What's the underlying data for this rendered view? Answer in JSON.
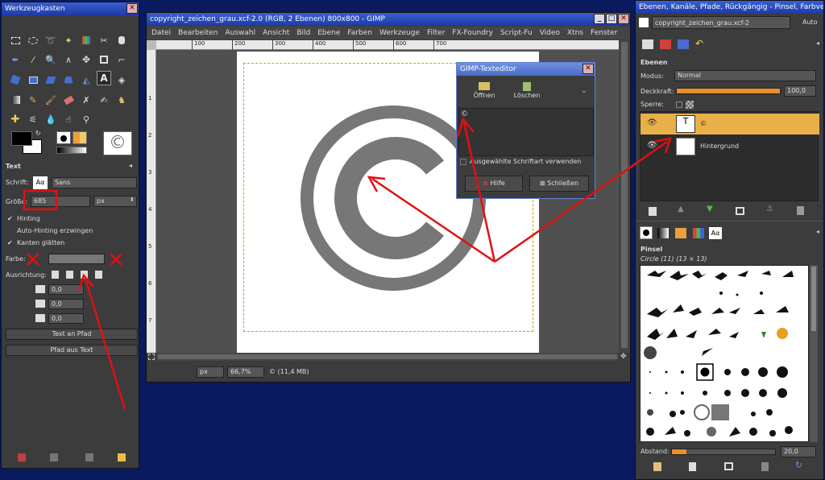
{
  "toolbox": {
    "title": "Werkzeugkasten",
    "text_options": {
      "heading": "Text",
      "font_label": "Schrift:",
      "font_value": "Sans",
      "size_label": "Größe:",
      "size_value": "685",
      "size_unit": "px",
      "hinting": "Hinting",
      "auto_hinting": "Auto-Hinting erzwingen",
      "antialias": "Kanten glätten",
      "color_label": "Farbe:",
      "justify_label": "Ausrichtung:",
      "indent_value": "0,0",
      "line_spacing_value": "0,0",
      "letter_spacing_value": "0,0",
      "text_along_path": "Text an Pfad",
      "path_from_text": "Pfad aus Text"
    },
    "font_icon": "Aα"
  },
  "image_window": {
    "title": "copyright_zeichen_grau.xcf-2.0 (RGB, 2 Ebenen) 800x800 - GIMP",
    "menu": [
      "Datei",
      "Bearbeiten",
      "Auswahl",
      "Ansicht",
      "Bild",
      "Ebene",
      "Farben",
      "Werkzeuge",
      "Filter",
      "FX-Foundry",
      "Script-Fu",
      "Video",
      "Xtns",
      "Fenster"
    ],
    "ruler_ticks": [
      "100",
      "200",
      "300",
      "400",
      "500",
      "600",
      "700"
    ],
    "vruler_ticks": [
      "1",
      "2",
      "3",
      "4",
      "5",
      "6",
      "7"
    ],
    "unit": "px",
    "zoom": "66,7%",
    "status": "© (11,4 MB)",
    "copyright_glyph": "©"
  },
  "text_editor": {
    "title": "GIMP-Texteditor",
    "open_label": "Öffnen",
    "clear_label": "Löschen",
    "text": "©",
    "use_font_label": "Ausgewählte Schriftart verwenden",
    "help_label": "Hilfe",
    "close_label": "Schließen"
  },
  "right_dock": {
    "title": "Ebenen, Kanäle, Pfade, Rückgängig - Pinsel, Farbverlä...",
    "image_select": "copyright_zeichen_grau.xcf-2",
    "auto_label": "Auto",
    "layers_heading": "Ebenen",
    "mode_label": "Modus:",
    "mode_value": "Normal",
    "opacity_label": "Deckkraft:",
    "opacity_value": "100,0",
    "opacity_fraction": 1.0,
    "lock_label": "Sperre:",
    "layers": [
      {
        "name": "©",
        "selected": true
      },
      {
        "name": "Hintergrund",
        "selected": false
      }
    ],
    "brushes_heading": "Pinsel",
    "brush_name": "Circle (11) (13 × 13)",
    "spacing_label": "Abstand:",
    "spacing_value": "20,0",
    "font_tab_icon": "Aα"
  },
  "colors": {
    "accent_title": "#2a4fc4",
    "selected_layer": "#e9b04a",
    "desktop": "#0a1a5e",
    "annotation": "#e01010"
  }
}
